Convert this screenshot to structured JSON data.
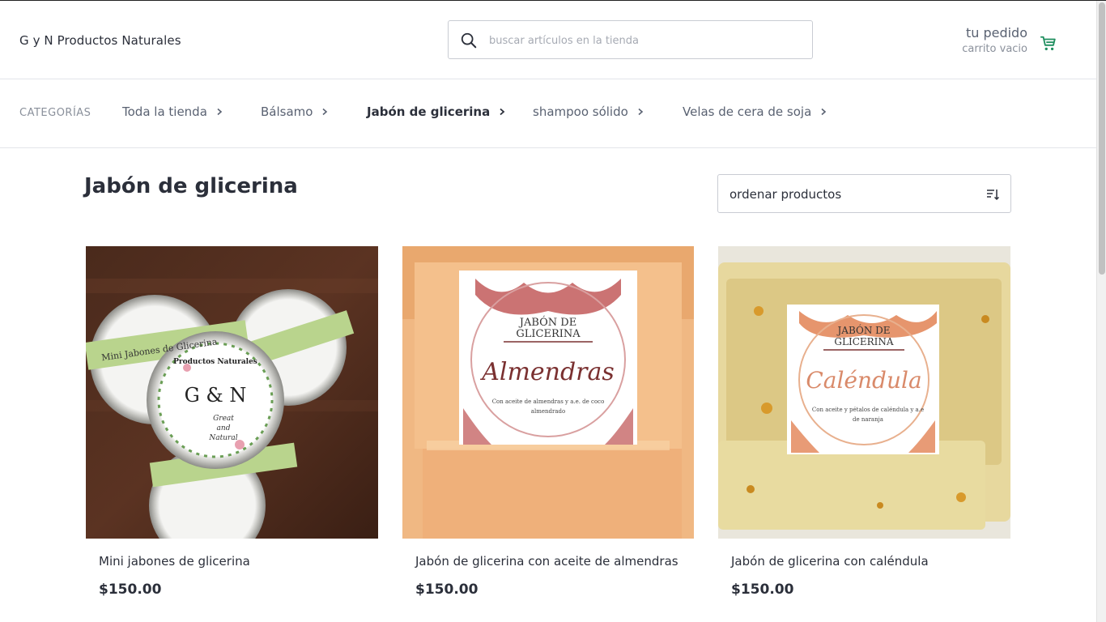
{
  "header": {
    "brand": "G y N Productos Naturales",
    "search_placeholder": "buscar artículos en la tienda",
    "cart_title": "tu pedido",
    "cart_status": "carrito vacio"
  },
  "categories": {
    "label": "CATEGORÍAS",
    "items": [
      {
        "label": "Toda la tienda",
        "active": false
      },
      {
        "label": "Bálsamo",
        "active": false
      },
      {
        "label": "Jabón de glicerina",
        "active": true
      },
      {
        "label": "shampoo sólido",
        "active": false
      },
      {
        "label": "Velas de cera de soja",
        "active": false
      }
    ]
  },
  "main": {
    "title": "Jabón de glicerina",
    "sort_label": "ordenar productos"
  },
  "products": [
    {
      "name": "Mini jabones de glicerina",
      "price": "$150.00",
      "image_text": {
        "brand_top": "Productos Naturales",
        "logo": "G & N",
        "tag1": "Great",
        "tag2": "and",
        "tag3": "Natural",
        "band": "Mini Jabones de Glicerina"
      }
    },
    {
      "name": "Jabón de glicerina con aceite de almendras",
      "price": "$150.00",
      "image_text": {
        "line1": "JABÓN DE",
        "line2": "GLICERINA",
        "script": "Almendras",
        "desc1": "Con aceite de almendras y a.e. de coco",
        "desc2": "almendrado"
      }
    },
    {
      "name": "Jabón de glicerina con caléndula",
      "price": "$150.00",
      "image_text": {
        "line1": "JABÓN DE",
        "line2": "GLICERINA",
        "script": "Caléndula",
        "desc1": "Con aceite y pétalos de caléndula y a.e",
        "desc2": "de naranja"
      }
    }
  ],
  "colors": {
    "accent": "#1f8f5f",
    "text": "#2b2f3a",
    "muted": "#8a909b"
  },
  "icons": {
    "search": "search-icon",
    "cart": "cart-icon",
    "chevron": "chevron-right-icon",
    "sort": "sort-icon"
  }
}
